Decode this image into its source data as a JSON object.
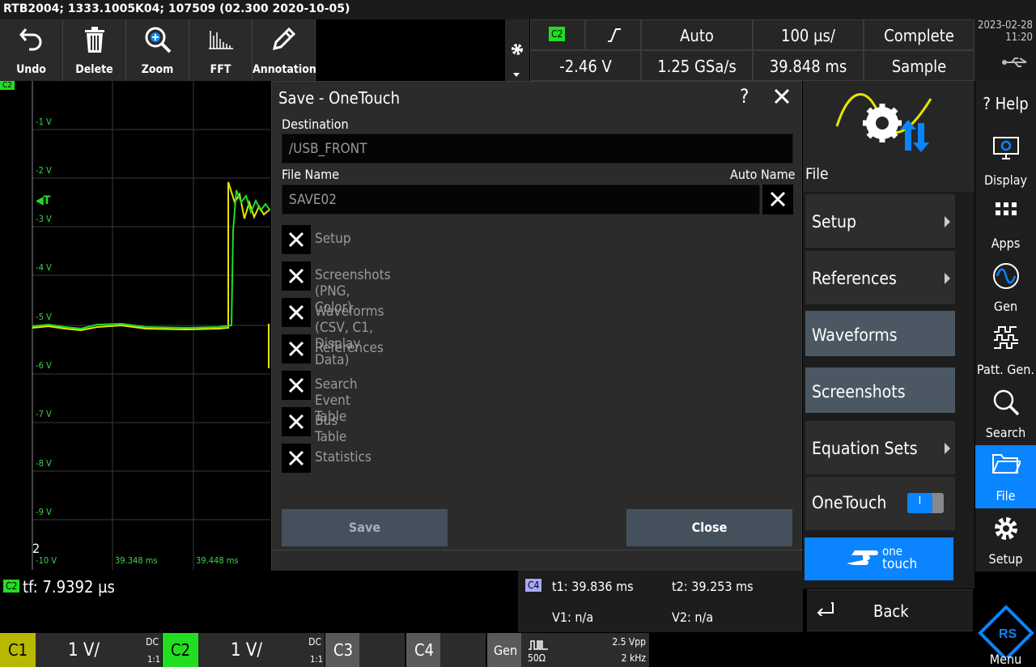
{
  "title_bar": "RTB2004; 1333.1005K04; 107509 (02.300 2020-10-05)",
  "toolbar": {
    "undo": "Undo",
    "delete": "Delete",
    "zoom": "Zoom",
    "fft": "FFT",
    "annotation": "Annotation"
  },
  "header": {
    "trigger_source": "C2",
    "trigger_mode": "Auto",
    "timebase": "100 µs/",
    "acq_status": "Complete",
    "trigger_level": "-2.46 V",
    "sample_rate": "1.25 GSa/s",
    "time_position": "39.848 ms",
    "acq_mode": "Sample",
    "date": "2023-02-28",
    "time": "11:20"
  },
  "plot": {
    "channel_tag": "C2",
    "trigger_marker": "T",
    "volt_labels": [
      "-1 V",
      "-2 V",
      "-3 V",
      "-4 V",
      "-5 V",
      "-6 V",
      "-7 V",
      "-8 V",
      "-9 V",
      "-10 V"
    ],
    "time_labels": [
      "39.348 ms",
      "39.448 ms"
    ],
    "ref_marker": "2"
  },
  "dialog": {
    "title": "Save - OneTouch",
    "help": "?",
    "destination_label": "Destination",
    "destination_value": "/USB_FRONT",
    "filename_label": "File Name",
    "autoname_label": "Auto Name",
    "filename_value": "SAVE02",
    "options": [
      "Setup",
      "Screenshots (PNG, Color)",
      "Waveforms (CSV, C1, Display Data)",
      "References",
      "Search Event Table",
      "Bus Table",
      "Statistics"
    ],
    "save": "Save",
    "close": "Close"
  },
  "file_menu": {
    "title": "File",
    "items": [
      {
        "label": "Setup"
      },
      {
        "label": "References"
      },
      {
        "label": "Waveforms"
      },
      {
        "label": "Screenshots"
      },
      {
        "label": "Equation Sets"
      },
      {
        "label": "OneTouch"
      }
    ],
    "onetouch_toggle": "I",
    "onetouch_one": "one",
    "onetouch_touch": "touch",
    "back": "Back"
  },
  "sidebar": {
    "help": "Help",
    "display": "Display",
    "apps": "Apps",
    "gen": "Gen",
    "patt_gen": "Patt. Gen.",
    "search": "Search",
    "file": "File",
    "setup": "Setup",
    "menu": "Menu"
  },
  "measure": {
    "tag": "C2",
    "value": "tf: 7.9392 µs"
  },
  "cursors": {
    "tag": "C4",
    "t1": "t1: 39.836 ms",
    "t2": "t2: 39.253 ms",
    "v1": "V1: n/a",
    "v2": "V2: n/a"
  },
  "channels": {
    "c1": {
      "label": "C1",
      "scale": "1 V/",
      "coupling": "DC",
      "probe": "1:1"
    },
    "c2": {
      "label": "C2",
      "scale": "1 V/",
      "coupling": "DC",
      "probe": "1:1"
    },
    "c3": {
      "label": "C3"
    },
    "c4": {
      "label": "C4"
    },
    "gen": {
      "label": "Gen",
      "amplitude": "2.5 Vpp",
      "impedance": "50Ω",
      "freq": "2 kHz"
    }
  },
  "colors": {
    "c1": "#e6e600",
    "c2": "#22dd22",
    "accent": "#0a84ff"
  }
}
